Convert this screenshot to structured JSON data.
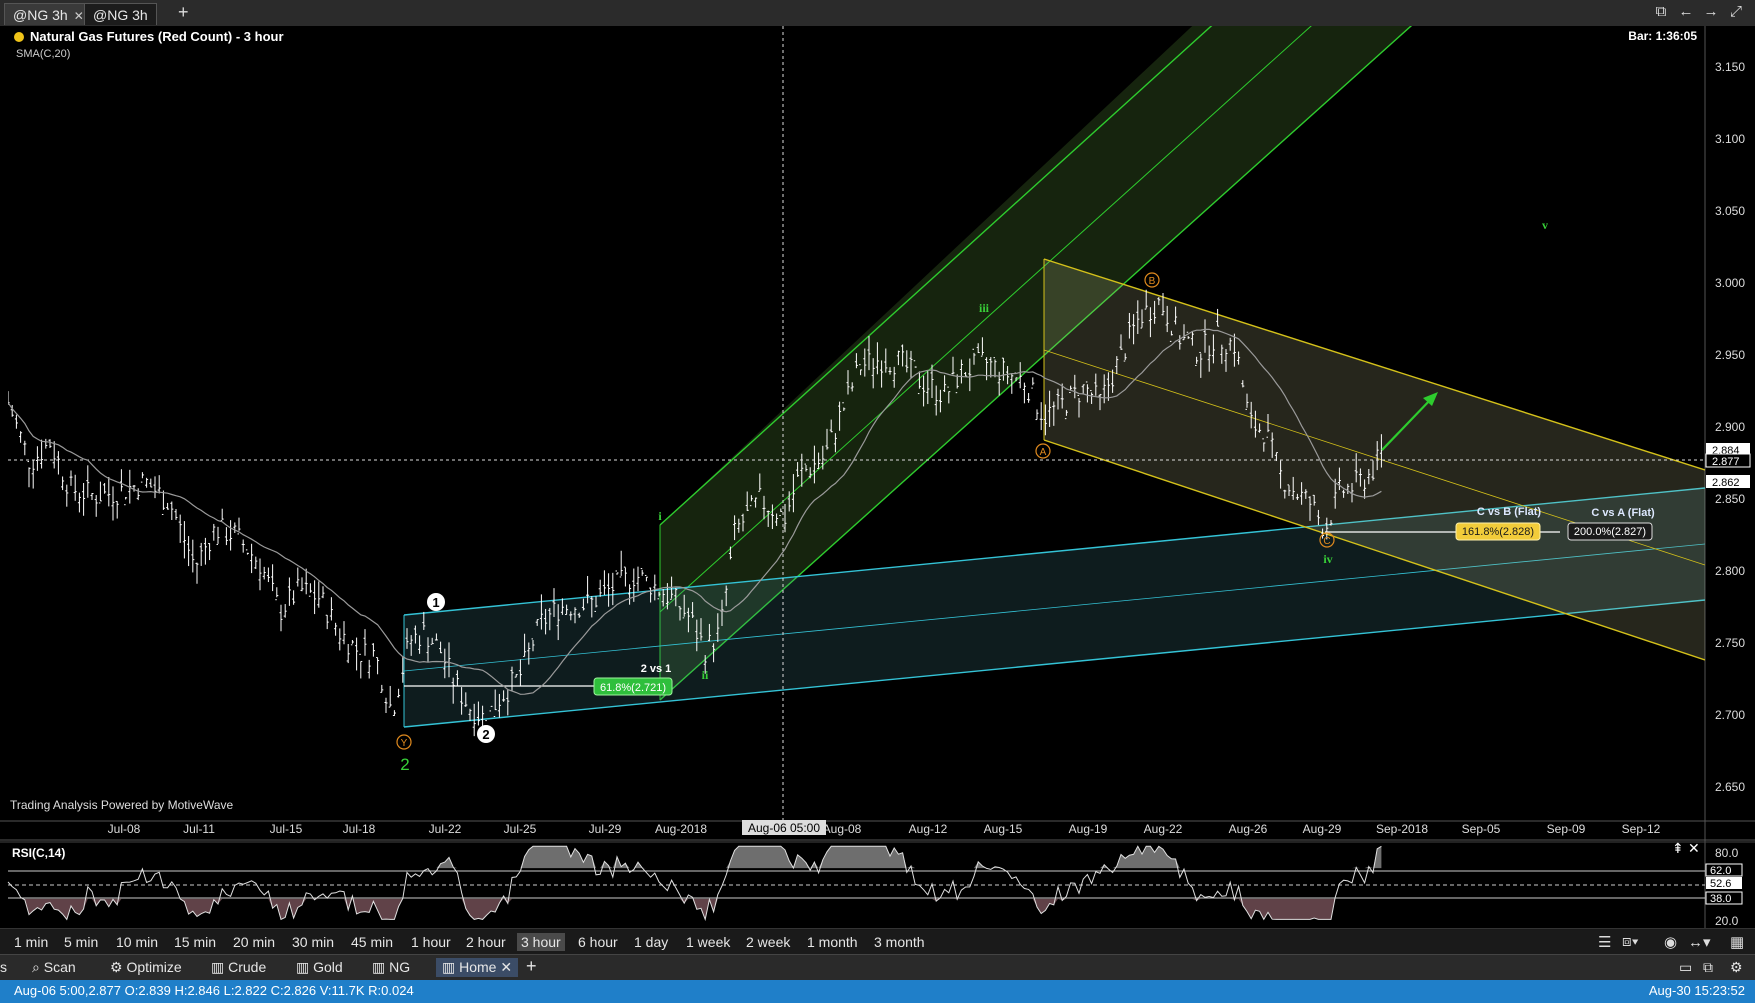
{
  "tabs": [
    {
      "label": "@NG 3h",
      "close": "✕",
      "active": true
    },
    {
      "label": "@NG 3h",
      "active": false
    }
  ],
  "tab_add": "+",
  "window_icons": [
    "popout-icon",
    "arrow-left-icon",
    "arrow-right-icon",
    "maximize-icon"
  ],
  "chart": {
    "title": "Natural Gas Futures (Red Count) - 3 hour",
    "indicator": "SMA(C,20)",
    "bar_timer": "Bar: 1:36:05",
    "powered_by": "Trading Analysis Powered by MotiveWave",
    "price_ticks": [
      "3.150",
      "3.100",
      "3.050",
      "3.000",
      "2.950",
      "2.900",
      "2.850",
      "2.800",
      "2.750",
      "2.700",
      "2.650"
    ],
    "price_markers": [
      {
        "label": "2.884",
        "color": "#ffffff"
      },
      {
        "label": "2.877",
        "color": "#ffffff"
      },
      {
        "label": "2.862",
        "color": "#ffffff"
      }
    ],
    "date_ticks": [
      "Jul-08",
      "Jul-11",
      "Jul-15",
      "Jul-18",
      "Jul-22",
      "Jul-25",
      "Jul-29",
      "Aug-2018",
      "Aug-08",
      "Aug-12",
      "Aug-15",
      "Aug-19",
      "Aug-22",
      "Aug-26",
      "Aug-29",
      "Sep-2018",
      "Sep-05",
      "Sep-09",
      "Sep-12"
    ],
    "crosshair_date": "Aug-06 05:00",
    "wave_labels": {
      "y": "Y",
      "two_big": "2",
      "one_circle": "1",
      "two_circle": "2",
      "i": "i",
      "ii": "ii",
      "iii": "iii",
      "iv": "iv",
      "v": "v",
      "a": "A",
      "b": "B",
      "c": "C"
    },
    "annotations": {
      "two_vs_one": "2 vs 1",
      "fib_618": "61.8%(2.721)",
      "c_vs_b": "C vs B (Flat)",
      "fib_1618": "161.8%(2.828)",
      "c_vs_a": "C vs A (Flat)",
      "fib_200": "200.0%(2.827)"
    },
    "colors": {
      "green_channel": "#2ecc2e",
      "yellow_channel": "#d4c11a",
      "cyan_channel": "#34c3d6",
      "price_bars": "#ffffff",
      "sma": "#9a9a9a",
      "wave_orange": "#e08a1e",
      "wave_green": "#38d038"
    }
  },
  "rsi": {
    "label": "RSI(C,14)",
    "ticks": [
      "80.0",
      "20.0"
    ],
    "levels": [
      "62.0",
      "52.6",
      "38.0"
    ],
    "controls": [
      "⇞",
      "✕"
    ]
  },
  "timeframes": [
    "1 min",
    "5 min",
    "10 min",
    "15 min",
    "20 min",
    "30 min",
    "45 min",
    "1 hour",
    "2 hour",
    "3 hour",
    "6 hour",
    "1 day",
    "1 week",
    "2 week",
    "1 month",
    "3 month"
  ],
  "selected_timeframe": "3 hour",
  "workspaces": [
    {
      "label": "s"
    },
    {
      "label": "Scan",
      "icon": "scan-icon"
    },
    {
      "label": "Optimize",
      "icon": "optimize-icon"
    },
    {
      "label": "Crude",
      "icon": "chart-icon"
    },
    {
      "label": "Gold",
      "icon": "chart-icon"
    },
    {
      "label": "NG",
      "icon": "chart-icon"
    },
    {
      "label": "Home",
      "icon": "chart-icon",
      "close": "✕",
      "active": true
    }
  ],
  "workspace_add": "+",
  "status": {
    "left": "Aug-06 5:00,2.877 O:2.839 H:2.846 L:2.822 C:2.826 V:11.7K R:0.024",
    "right": "Aug-30 15:23:52"
  }
}
